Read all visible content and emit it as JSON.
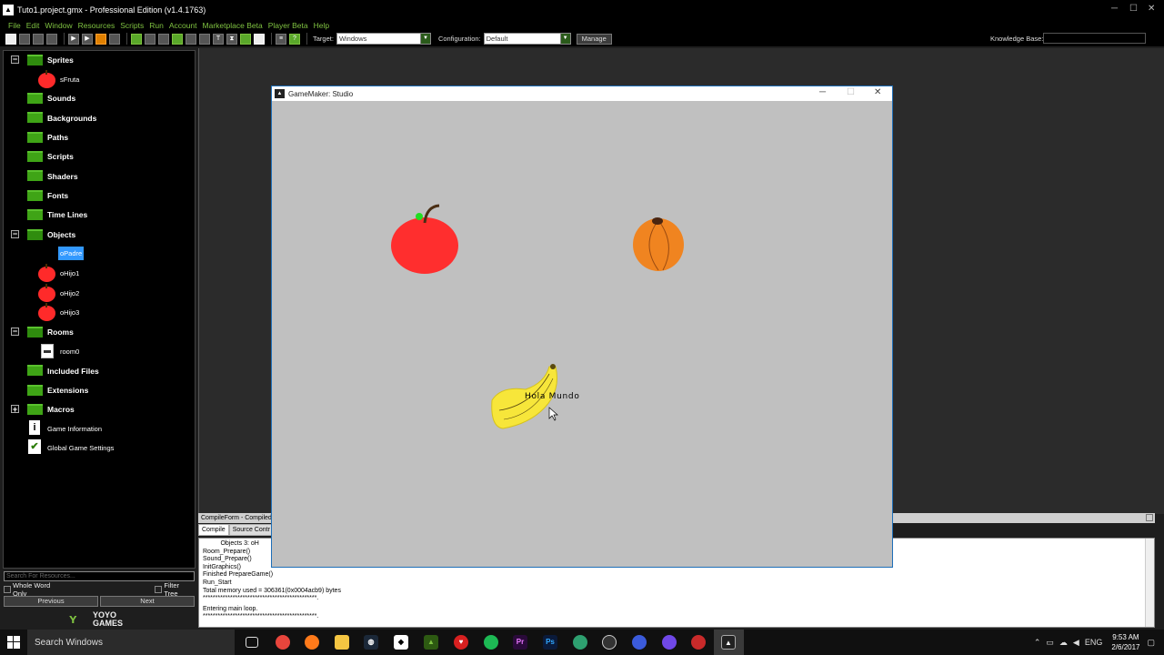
{
  "window": {
    "title": "Tuto1.project.gmx  -  Professional Edition (v1.4.1763)",
    "minimize": "─",
    "restore": "☐",
    "close": "✕"
  },
  "menu": [
    "File",
    "Edit",
    "Window",
    "Resources",
    "Scripts",
    "Run",
    "Account",
    "Marketplace Beta",
    "Player Beta",
    "Help"
  ],
  "toolbar": {
    "target_label": "Target:",
    "target_value": "Windows",
    "config_label": "Configuration:",
    "config_value": "Default",
    "manage_label": "Manage",
    "kb_label": "Knowledge Base:"
  },
  "tree": {
    "sprites": "Sprites",
    "sprite_items": [
      "sFruta"
    ],
    "sounds": "Sounds",
    "backgrounds": "Backgrounds",
    "paths": "Paths",
    "scripts": "Scripts",
    "shaders": "Shaders",
    "fonts": "Fonts",
    "timelines": "Time Lines",
    "objects": "Objects",
    "object_items": [
      "oPadre",
      "oHijo1",
      "oHijo2",
      "oHijo3"
    ],
    "rooms": "Rooms",
    "room_items": [
      "room0"
    ],
    "included_files": "Included Files",
    "extensions": "Extensions",
    "macros": "Macros",
    "game_information": "Game Information",
    "global_settings": "Global Game Settings",
    "toggle_expanded": "−",
    "toggle_collapsed": "+"
  },
  "tree_footer": {
    "search_placeholder": "Search For Resources...",
    "whole_word": "Whole Word Only",
    "filter_tree": "Filter Tree",
    "previous": "Previous",
    "next": "Next",
    "logo_line1": "YOYO",
    "logo_line2": "GAMES"
  },
  "compile": {
    "title": "CompileForm - Compiled",
    "tabs": [
      "Compile",
      "Source Contr"
    ],
    "lines": [
      "          Objects 3: oH",
      "Room_Prepare()",
      "Sound_Prepare()",
      "InitGraphics()",
      "Finished PrepareGame()",
      "Run_Start",
      "Total memory used = 306361(0x0004acb9) bytes",
      "**********************************************.",
      "Entering main loop.",
      "**********************************************."
    ]
  },
  "game_window": {
    "title": "GameMaker: Studio",
    "text": "Hola Mundo"
  },
  "taskbar": {
    "search": "Search Windows",
    "language": "ENG",
    "time": "9:53 AM",
    "date": "2/6/2017"
  },
  "colors": {
    "menu_green": "#7fc241",
    "folder_green": "#3fa416",
    "game_bg": "#c0c0c0",
    "apple_red": "#ff2a2a",
    "orange": "#f08420",
    "banana": "#f7e63a"
  }
}
